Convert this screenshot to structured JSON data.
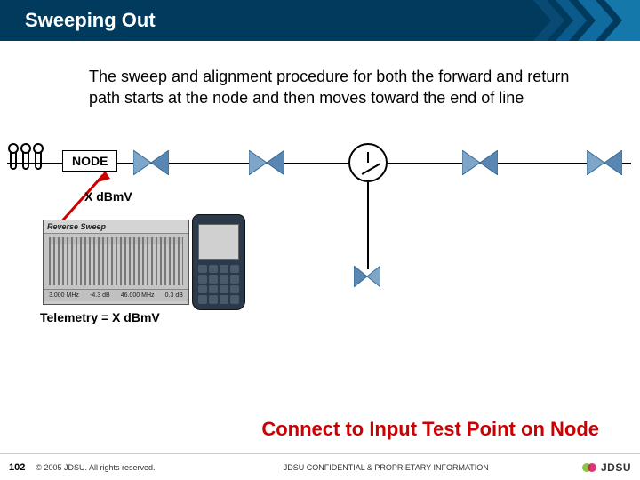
{
  "header": {
    "title": "Sweeping Out"
  },
  "body": {
    "paragraph": "The sweep and alignment procedure for both the forward and return path starts at the node and then moves toward the end of line"
  },
  "diagram": {
    "node_label": "NODE",
    "x_label": "X dBmV",
    "telemetry_label": "Telemetry = X dBmV",
    "screenshot_title": "Reverse Sweep",
    "screenshot_footer_values": [
      "3.000 MHz",
      "-4.3 dB",
      "46.000 MHz",
      "0.3 dB"
    ]
  },
  "callout": "Connect to Input Test Point on Node",
  "footer": {
    "page": "102",
    "copyright": "© 2005 JDSU. All rights reserved.",
    "confidential": "JDSU CONFIDENTIAL & PROPRIETARY INFORMATION",
    "logo_text": "JDSU"
  }
}
